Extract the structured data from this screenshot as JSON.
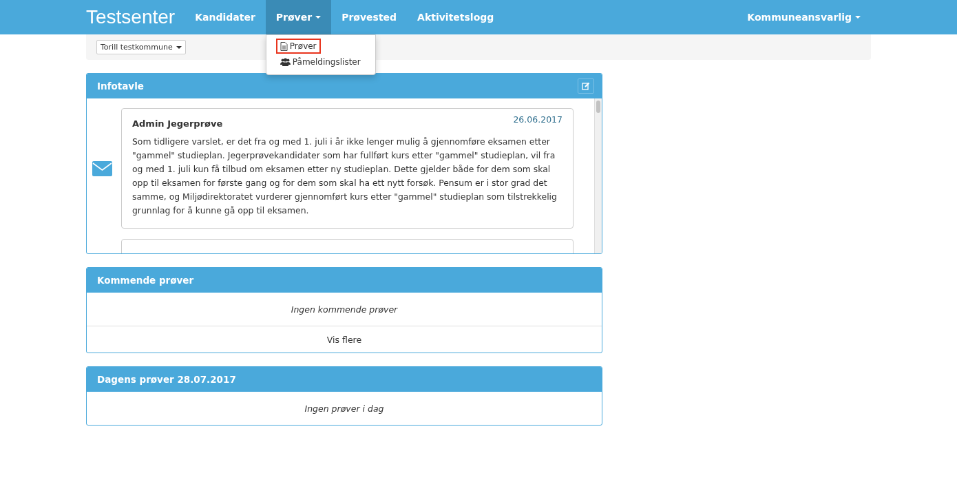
{
  "navbar": {
    "brand": "Testsenter",
    "items": [
      {
        "label": "Kandidater",
        "selected": false,
        "dropdown": false
      },
      {
        "label": "Prøver",
        "selected": true,
        "dropdown": true
      },
      {
        "label": "Prøvested",
        "selected": false,
        "dropdown": false
      },
      {
        "label": "Aktivitetslogg",
        "selected": false,
        "dropdown": false
      }
    ],
    "user_menu": "Kommuneansvarlig"
  },
  "dropdown_menu": {
    "items": [
      {
        "label": "Prøver",
        "kind": "document",
        "highlighted": true
      },
      {
        "label": "Påmeldingslister",
        "kind": "group",
        "highlighted": false
      }
    ]
  },
  "municipality_select": "Torill testkommune",
  "infotavle": {
    "title": "Infotavle",
    "messages": [
      {
        "author": "Admin Jegerprøve",
        "date": "26.06.2017",
        "text": "Som tidligere varslet, er det fra og med 1. juli i år ikke lenger mulig å gjennomføre eksamen etter \"gammel\" studieplan. Jegerprøvekandidater som har fullført kurs etter \"gammel\" studieplan, vil fra og med 1. juli kun få tilbud om eksamen etter ny studieplan. Dette gjelder både for dem som skal opp til eksamen for første gang og for dem som skal ha ett nytt forsøk. Pensum er i stor grad det samme, og Miljødirektoratet vurderer gjennomført kurs etter \"gammel\" studieplan som tilstrekkelig grunnlag for å kunne gå opp til eksamen."
      }
    ]
  },
  "upcoming": {
    "title": "Kommende prøver",
    "empty_text": "Ingen kommende prøver",
    "more_link": "Vis flere"
  },
  "today": {
    "title": "Dagens prøver 28.07.2017",
    "empty_text": "Ingen prøver i dag"
  }
}
